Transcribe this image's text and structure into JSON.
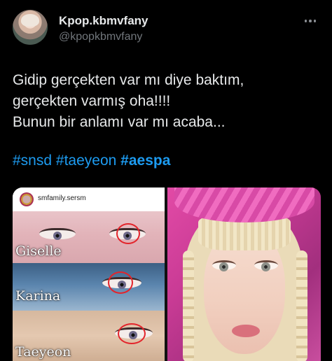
{
  "author": {
    "display_name": "Kpop.kbmvfany",
    "handle": "@kpopkbmvfany"
  },
  "tweet": {
    "lines": [
      "Gidip gerçekten var mı diye baktım,",
      "gerçekten varmış oha!!!!",
      "Bunun bir anlamı var mı acaba..."
    ],
    "hashtags": [
      "#snsd",
      "#taeyeon",
      "#aespa"
    ]
  },
  "media": {
    "left_image": {
      "account": "smfamily.sersm",
      "labels": [
        "Giselle",
        "Karina",
        "Taeyeon"
      ]
    }
  },
  "colors": {
    "background": "#000000",
    "text": "#e7e9ea",
    "muted": "#71767b",
    "link": "#1d9bf0",
    "highlight_circle": "#e3242b"
  },
  "icons": {
    "more": "more-horizontal-icon"
  }
}
